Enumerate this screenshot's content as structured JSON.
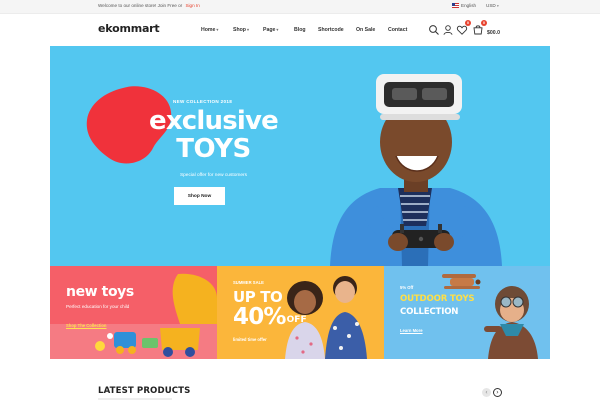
{
  "topbar": {
    "welcome_text": "Welcome to our online store! Join Free or",
    "signin_label": "Sign In",
    "language": "English",
    "currency": "USD"
  },
  "header": {
    "logo": "ekommart",
    "nav": [
      {
        "label": "Home",
        "dropdown": true
      },
      {
        "label": "Shop",
        "dropdown": true
      },
      {
        "label": "Page",
        "dropdown": true
      },
      {
        "label": "Blog",
        "dropdown": false
      },
      {
        "label": "Shortcode",
        "dropdown": false
      },
      {
        "label": "On Sale",
        "dropdown": false
      },
      {
        "label": "Contact",
        "dropdown": false
      }
    ],
    "icons": [
      "search-icon",
      "user-icon",
      "heart-icon",
      "cart-icon"
    ],
    "wishlist_count": "0",
    "cart_count": "0",
    "cart_total": "$00.0"
  },
  "hero": {
    "subtitle": "NEW COLLECTION 2018",
    "title_line1": "exclusive",
    "title_line2": "TOYS",
    "offer_text": "Special offer for new customers",
    "button_label": "Shop Now",
    "bg_color": "#53c7f0",
    "blob_color": "#f0323b"
  },
  "banners": [
    {
      "title": "new toys",
      "subtitle": "Perfect education for your child",
      "link": "Shop The Collection",
      "bg_color": "#f55f68"
    },
    {
      "tag": "SUMMER SALE",
      "title_line1": "UP TO",
      "title_line2": "40%",
      "title_suffix": "OFF",
      "subtitle": "limited time offer",
      "bg_color": "#fbb63b"
    },
    {
      "tag": "5% Off",
      "title_line1": "OUTDOOR TOYS",
      "title_line2": "COLLECTION",
      "link": "Learn More",
      "bg_color": "#70c1ee"
    }
  ],
  "latest": {
    "title": "LATEST PRODUCTS"
  }
}
